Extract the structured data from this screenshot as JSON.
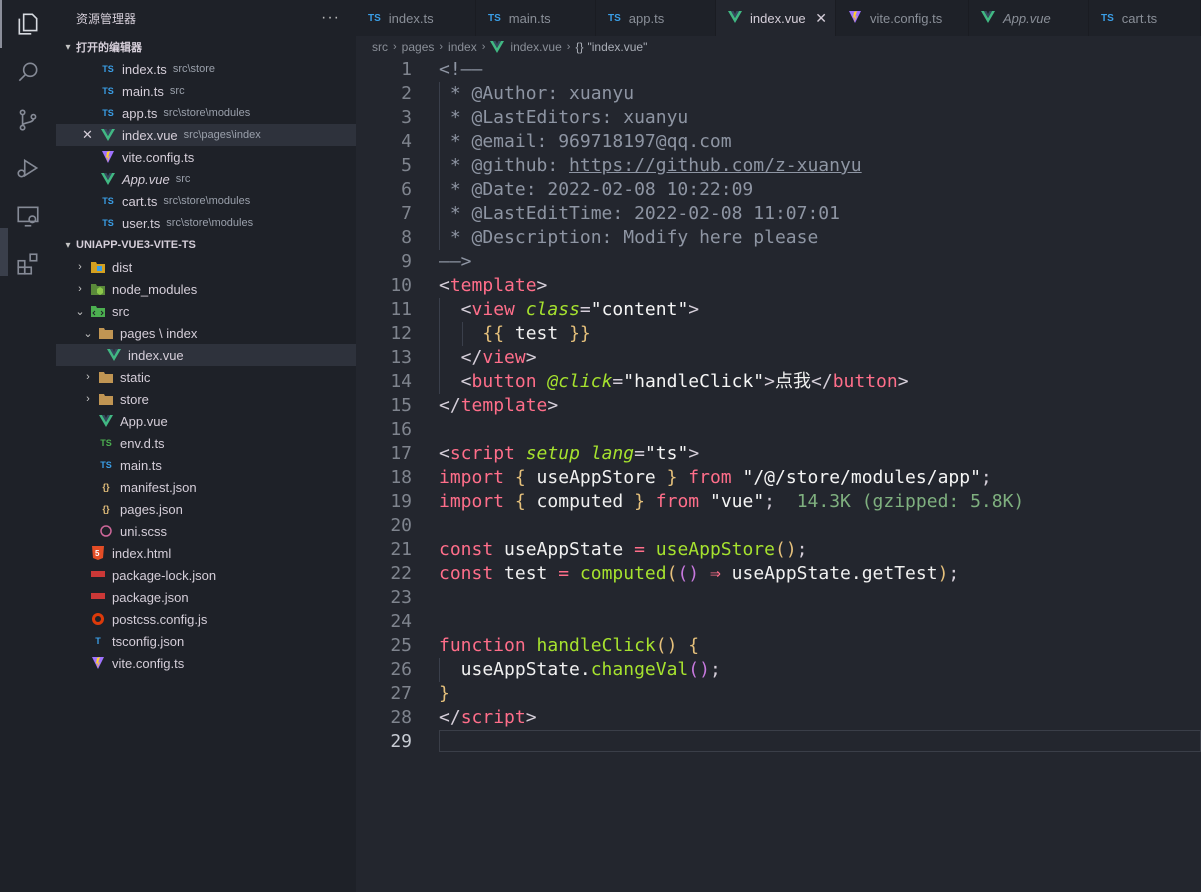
{
  "sidebar": {
    "title": "资源管理器",
    "more": "···",
    "open_editors_title": "打开的编辑器",
    "project_title": "UNIAPP-VUE3-VITE-TS",
    "open_editors": [
      {
        "name": "index.ts",
        "desc": "src\\store",
        "icon": "TS"
      },
      {
        "name": "main.ts",
        "desc": "src",
        "icon": "TS"
      },
      {
        "name": "app.ts",
        "desc": "src\\store\\modules",
        "icon": "TS"
      },
      {
        "name": "index.vue",
        "desc": "src\\pages\\index",
        "icon": "V",
        "close": "✕"
      },
      {
        "name": "vite.config.ts",
        "desc": "",
        "icon": "vite"
      },
      {
        "name": "App.vue",
        "desc": "src",
        "icon": "V"
      },
      {
        "name": "cart.ts",
        "desc": "src\\store\\modules",
        "icon": "TS"
      },
      {
        "name": "user.ts",
        "desc": "src\\store\\modules",
        "icon": "TS"
      }
    ],
    "tree": [
      {
        "name": "dist"
      },
      {
        "name": "node_modules"
      },
      {
        "name": "src"
      },
      {
        "name": "pages \\ index"
      },
      {
        "name": "index.vue"
      },
      {
        "name": "static"
      },
      {
        "name": "store"
      },
      {
        "name": "App.vue"
      },
      {
        "name": "env.d.ts",
        "icon": "TS"
      },
      {
        "name": "main.ts",
        "icon": "TS"
      },
      {
        "name": "manifest.json",
        "icon": "{}"
      },
      {
        "name": "pages.json",
        "icon": "{}"
      },
      {
        "name": "uni.scss"
      },
      {
        "name": "index.html"
      },
      {
        "name": "package-lock.json"
      },
      {
        "name": "package.json"
      },
      {
        "name": "postcss.config.js"
      },
      {
        "name": "tsconfig.json"
      },
      {
        "name": "vite.config.ts"
      }
    ]
  },
  "tabs": [
    {
      "label": "index.ts",
      "icon": "TS"
    },
    {
      "label": "main.ts",
      "icon": "TS"
    },
    {
      "label": "app.ts",
      "icon": "TS"
    },
    {
      "label": "index.vue",
      "icon": "V",
      "close": "✕"
    },
    {
      "label": "vite.config.ts",
      "icon": "vite"
    },
    {
      "label": "App.vue",
      "icon": "V"
    },
    {
      "label": "cart.ts",
      "icon": "TS"
    }
  ],
  "breadcrumb": {
    "items": [
      "src",
      "pages",
      "index",
      "index.vue",
      "\"index.vue\""
    ],
    "braces": "{}"
  },
  "editor": {
    "line_numbers": [
      "1",
      "2",
      "3",
      "4",
      "5",
      "6",
      "7",
      "8",
      "9",
      "10",
      "11",
      "12",
      "13",
      "14",
      "15",
      "16",
      "17",
      "18",
      "19",
      "20",
      "21",
      "22",
      "23",
      "24",
      "25",
      "26",
      "27",
      "28",
      "29"
    ],
    "comment": {
      "open": "<!——",
      "author": " * @Author: xuanyu",
      "last_editors": " * @LastEditors: xuanyu",
      "email": " * @email: 969718197@qq.com",
      "github_prefix": " * @github: ",
      "github_url": "https://github.com/z-xuanyu",
      "date": " * @Date: 2022-02-08 10:22:09",
      "last_edit": " * @LastEditTime: 2022-02-08 11:07:01",
      "description": " * @Description: Modify here please",
      "close": "——>"
    },
    "template": {
      "tag_template": "template",
      "tag_view": "view",
      "attr_class": "class",
      "class_val": "\"content\"",
      "interp_open": "{{",
      "interp_var": " test ",
      "interp_close": "}}",
      "tag_button": "button",
      "attr_click": "@click",
      "click_val": "\"handleClick\"",
      "button_text": "点我"
    },
    "script": {
      "tag_script": "script",
      "attr_setup": "setup",
      "attr_lang": "lang",
      "lang_val": "\"ts\"",
      "import": "import",
      "from": "from",
      "import1_name": " useAppStore ",
      "import1_path": "\"/@/store/modules/app\"",
      "import2_name": " computed ",
      "import2_path": "\"vue\"",
      "import2_hint": "14.3K (gzipped: 5.8K)",
      "const": "const",
      "var1": " useAppState ",
      "fn_useAppStore": "useAppStore",
      "var2": " test ",
      "fn_computed": "computed",
      "arrow": "⇒",
      "getter": " useAppState.getTest",
      "function_kw": "function",
      "fn_handle": "handleClick",
      "call_obj": "  useAppState.",
      "call_fn": "changeVal"
    }
  }
}
